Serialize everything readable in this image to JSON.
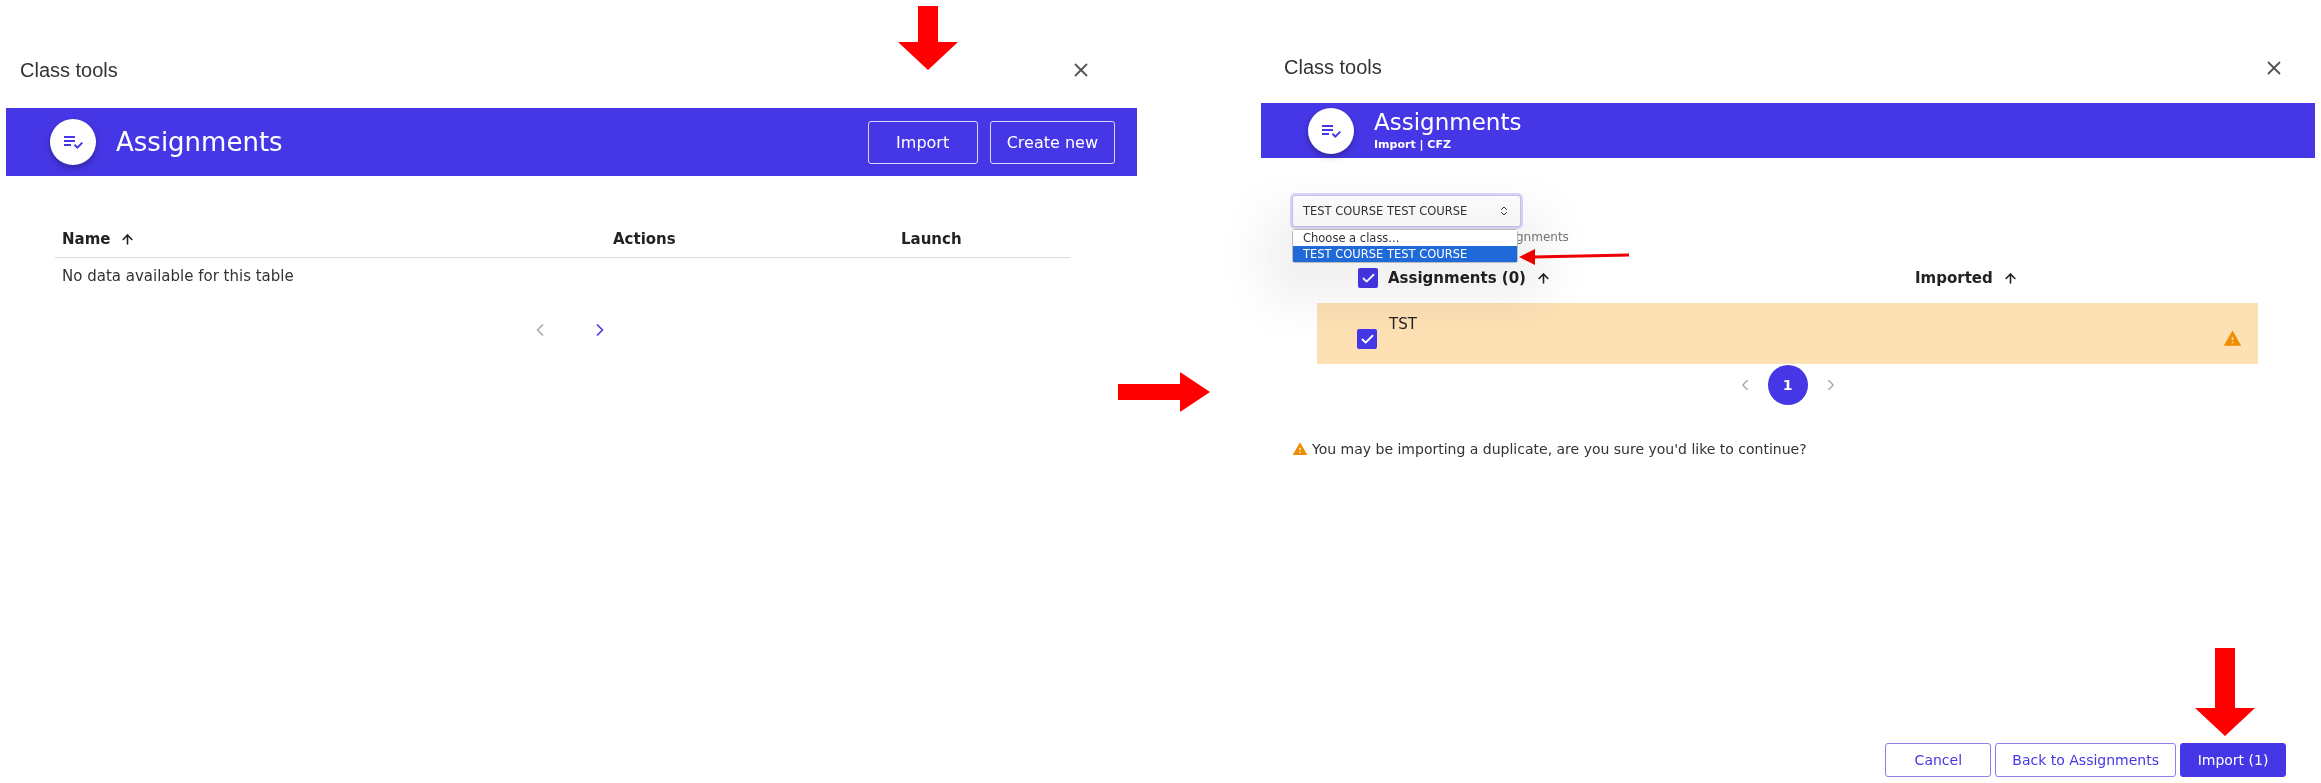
{
  "left_dialog": {
    "title": "Class tools",
    "header": {
      "title": "Assignments",
      "buttons": [
        "Import",
        "Create new"
      ]
    },
    "table": {
      "columns": [
        {
          "label": "Name",
          "sorted": true
        },
        {
          "label": "Actions"
        },
        {
          "label": "Launch"
        }
      ],
      "empty_message": "No data available for this table"
    }
  },
  "right_dialog": {
    "title": "Class tools",
    "header": {
      "title": "Assignments",
      "subtitle": "Import | CFZ"
    },
    "class_select": {
      "value": "TEST COURSE TEST COURSE",
      "expanded": true,
      "options": [
        {
          "label": "Choose a class...",
          "selected": false
        },
        {
          "label": "TEST COURSE TEST COURSE",
          "selected": true
        }
      ]
    },
    "hidden_label": "gnments",
    "table": {
      "columns": [
        {
          "label": "Assignments (0)",
          "checked": true,
          "sorted": true
        },
        {
          "label": "Imported",
          "sorted": true
        }
      ],
      "rows": [
        {
          "name": "TST",
          "checked": true,
          "warning": true
        }
      ]
    },
    "pagination": {
      "pages": [
        {
          "label": "1",
          "selected": true
        }
      ]
    },
    "warning": "You may be importing a duplicate, are you sure you'd like to continue?",
    "buttons": [
      {
        "label": "Cancel",
        "kind": "outline"
      },
      {
        "label": "Back to Assignments",
        "kind": "outline"
      },
      {
        "label": "Import (1)",
        "kind": "primary"
      }
    ]
  }
}
